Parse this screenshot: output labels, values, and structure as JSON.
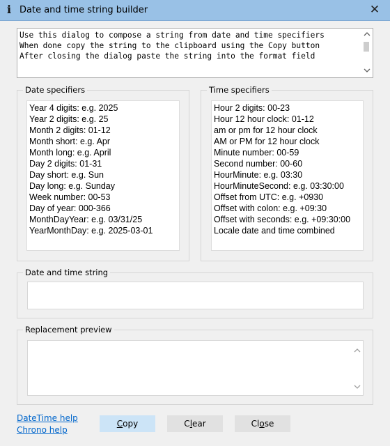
{
  "window": {
    "title": "Date and time string builder",
    "info_glyph": "i",
    "close_glyph": "✕"
  },
  "instructions": [
    "Use this dialog to compose a string from date and time specifiers",
    "When done copy the string to the clipboard using the Copy button",
    "After closing the dialog paste the string into the format field"
  ],
  "date_group": {
    "label": "Date specifiers",
    "items": [
      "Year 4 digits: e.g. 2025",
      "Year 2 digits: e.g. 25",
      "Month 2 digits: 01-12",
      "Month short: e.g. Apr",
      "Month long: e.g. April",
      "Day 2 digits: 01-31",
      "Day short: e.g. Sun",
      "Day long: e.g. Sunday",
      "Week number: 00-53",
      "Day of year: 000-366",
      "MonthDayYear: e.g. 03/31/25",
      "YearMonthDay: e.g. 2025-03-01"
    ]
  },
  "time_group": {
    "label": "Time specifiers",
    "items": [
      "Hour 2 digits: 00-23",
      "Hour 12 hour clock: 01-12",
      "am or pm for 12 hour clock",
      "AM or PM for 12 hour clock",
      "Minute number: 00-59",
      "Second number: 00-60",
      "HourMinute: e.g. 03:30",
      "HourMinuteSecond: e.g. 03:30:00",
      "Offset from UTC: e.g. +0930",
      "Offset with colon: e.g. +09:30",
      "Offset with seconds: e.g. +09:30:00",
      "Locale date and time combined"
    ]
  },
  "datetime_string": {
    "label": "Date and time string",
    "value": ""
  },
  "preview": {
    "label": "Replacement preview",
    "value": ""
  },
  "links": {
    "datetime_help": "DateTime help",
    "chrono_help": "Chrono help"
  },
  "buttons": {
    "copy": {
      "pre": "",
      "key": "C",
      "post": "opy"
    },
    "clear": {
      "pre": "C",
      "key": "l",
      "post": "ear"
    },
    "close": {
      "pre": "Cl",
      "key": "o",
      "post": "se"
    }
  },
  "icons": {
    "info": "info-icon",
    "close": "close-icon",
    "scroll_up": "chevron-up-icon",
    "scroll_down": "chevron-down-icon"
  },
  "colors": {
    "titlebar": "#99c1e6",
    "default_button": "#cce4f7",
    "link": "#0066cc"
  }
}
